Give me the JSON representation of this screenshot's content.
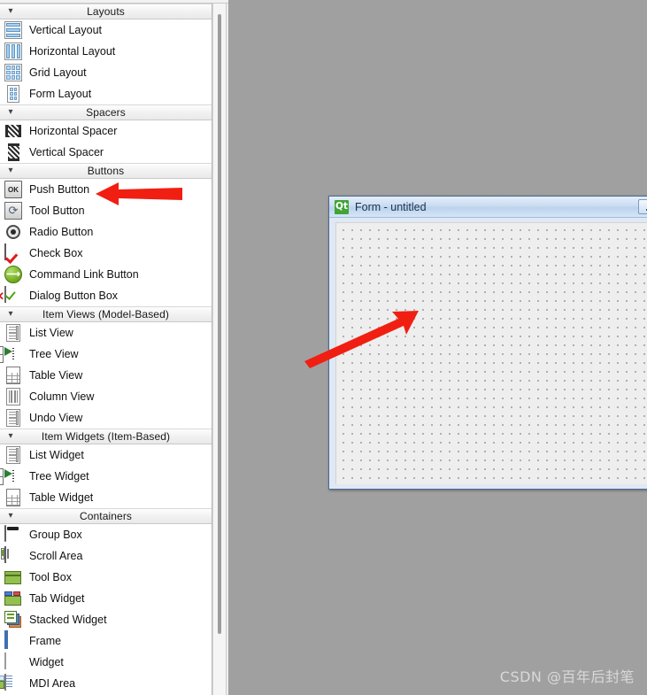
{
  "widget_box": {
    "sections": [
      {
        "title": "Layouts",
        "collapse_icon": "chevron-down-icon",
        "items": [
          {
            "label": "Vertical Layout",
            "icon": "vertical-layout-icon"
          },
          {
            "label": "Horizontal Layout",
            "icon": "horizontal-layout-icon"
          },
          {
            "label": "Grid Layout",
            "icon": "grid-layout-icon"
          },
          {
            "label": "Form Layout",
            "icon": "form-layout-icon"
          }
        ]
      },
      {
        "title": "Spacers",
        "collapse_icon": "chevron-down-icon",
        "items": [
          {
            "label": "Horizontal Spacer",
            "icon": "horizontal-spacer-icon"
          },
          {
            "label": "Vertical Spacer",
            "icon": "vertical-spacer-icon"
          }
        ]
      },
      {
        "title": "Buttons",
        "collapse_icon": "chevron-down-icon",
        "items": [
          {
            "label": "Push Button",
            "icon": "push-button-icon",
            "icon_text": "OK"
          },
          {
            "label": "Tool Button",
            "icon": "tool-button-icon"
          },
          {
            "label": "Radio Button",
            "icon": "radio-button-icon"
          },
          {
            "label": "Check Box",
            "icon": "check-box-icon"
          },
          {
            "label": "Command Link Button",
            "icon": "command-link-button-icon"
          },
          {
            "label": "Dialog Button Box",
            "icon": "dialog-button-box-icon"
          }
        ]
      },
      {
        "title": "Item Views (Model-Based)",
        "collapse_icon": "chevron-down-icon",
        "items": [
          {
            "label": "List View",
            "icon": "list-view-icon"
          },
          {
            "label": "Tree View",
            "icon": "tree-view-icon"
          },
          {
            "label": "Table View",
            "icon": "table-view-icon"
          },
          {
            "label": "Column View",
            "icon": "column-view-icon"
          },
          {
            "label": "Undo View",
            "icon": "undo-view-icon"
          }
        ]
      },
      {
        "title": "Item Widgets (Item-Based)",
        "collapse_icon": "chevron-down-icon",
        "items": [
          {
            "label": "List Widget",
            "icon": "list-widget-icon"
          },
          {
            "label": "Tree Widget",
            "icon": "tree-widget-icon"
          },
          {
            "label": "Table Widget",
            "icon": "table-widget-icon"
          }
        ]
      },
      {
        "title": "Containers",
        "collapse_icon": "chevron-down-icon",
        "items": [
          {
            "label": "Group Box",
            "icon": "group-box-icon"
          },
          {
            "label": "Scroll Area",
            "icon": "scroll-area-icon"
          },
          {
            "label": "Tool Box",
            "icon": "tool-box-icon"
          },
          {
            "label": "Tab Widget",
            "icon": "tab-widget-icon"
          },
          {
            "label": "Stacked Widget",
            "icon": "stacked-widget-icon"
          },
          {
            "label": "Frame",
            "icon": "frame-icon"
          },
          {
            "label": "Widget",
            "icon": "widget-icon"
          },
          {
            "label": "MDI Area",
            "icon": "mdi-area-icon"
          }
        ]
      }
    ]
  },
  "form_window": {
    "logo_text": "Qt",
    "title": "Form - untitled",
    "minimize_icon": "minimize-icon"
  },
  "annotations": [
    {
      "name": "arrow-to-push-button",
      "direction": "left",
      "color": "#f01f12"
    },
    {
      "name": "arrow-to-form-canvas",
      "direction": "up-right",
      "color": "#f01f12"
    }
  ],
  "watermark": {
    "text": "CSDN @百年后封笔"
  },
  "colors": {
    "background": "#a0a0a0",
    "panel_background": "#ffffff",
    "section_header": "#f0f0f0",
    "form_titlebar": "#cbdcf1",
    "qt_green": "#40a436",
    "arrow_red": "#f01f12"
  }
}
